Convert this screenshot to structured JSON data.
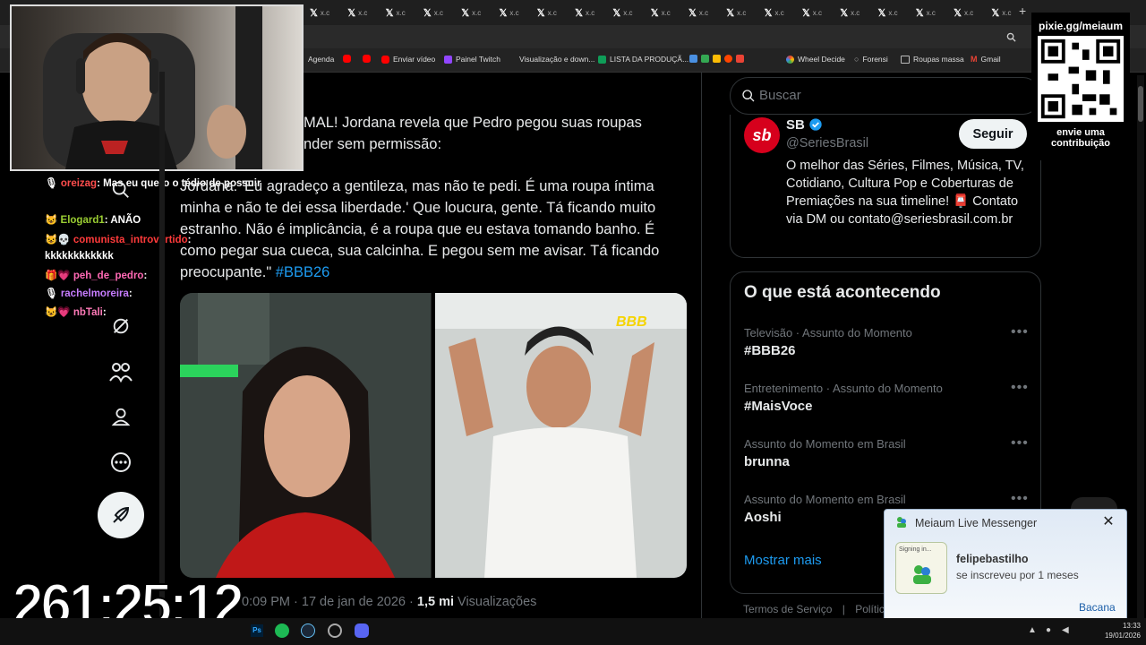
{
  "browser": {
    "tab_label": "x.c",
    "bookmarks": [
      {
        "label": "Agenda",
        "color": "#4a7bd0"
      },
      {
        "label": "",
        "color": "#ff0000"
      },
      {
        "label": "Enviar vídeo",
        "color": "#ff0000"
      },
      {
        "label": "Painel Twitch",
        "color": "#9146ff"
      },
      {
        "label": "Visualização e down...",
        "color": ""
      },
      {
        "label": "LISTA DA PRODUÇÃ...",
        "color": "#0f9d58"
      },
      {
        "label": "Wheel Decide",
        "color": "#ffb300"
      },
      {
        "label": "Forensi",
        "color": "#888888"
      },
      {
        "label": "Roupas massa",
        "color": "#aaaaaa"
      },
      {
        "label": "Gmail",
        "color": "#ea4335"
      }
    ]
  },
  "overlay": {
    "qr_url": "pixie.gg/meiaum",
    "qr_caption": "envie uma contribuição",
    "timer": "261:25:12"
  },
  "chat": [
    {
      "user": "oreizag",
      "user_color": "#ff4d4d",
      "sep": ":",
      "message": "Mas eu quero o tédio de possuir"
    },
    {
      "user": "Elogard1",
      "user_color": "#9acd32",
      "sep": ":",
      "message": "ANÃO"
    },
    {
      "user": "comunista_introvertido",
      "user_color": "#ff3b3b",
      "sep": ":",
      "message": "kkkkkkkkkkkk"
    },
    {
      "user": "peh_de_pedro",
      "user_color": "#ff69b4",
      "sep": ":",
      "message": ""
    },
    {
      "user": "rachelmoreira",
      "user_color": "#c77dff",
      "sep": ":",
      "message": ""
    },
    {
      "user": "nbTali",
      "user_color": "#ff7ab8",
      "sep": ":",
      "message": ""
    }
  ],
  "tweet": {
    "headline_lines": [
      "MAL! Jordana revela que Pedro pegou suas roupas",
      "nder sem permissão:"
    ],
    "body_prefix": "Jordana: 'Eu agradeço a gentileza, mas não te pedi. É uma roupa íntima minha e não te dei essa liberdade.' Que loucura, gente. Tá ficando muito estranho. Não é implicância, é a roupa que eu estava tomando banho. É como pegar sua cueca, sua calcinha. E pegou sem me avisar. Tá ficando preocupante.\"",
    "hashtag": "#BBB26",
    "timestamp_suffix": "0:09 PM · 17 de jan de 2026 ·",
    "views_count": "1,5 mi",
    "views_label": "Visualizações",
    "media_badge": "BBB"
  },
  "right": {
    "search_placeholder": "Buscar",
    "profile": {
      "name": "SB",
      "handle": "@SeriesBrasil",
      "follow_label": "Seguir",
      "bio": "O melhor das Séries, Filmes, Música, TV, Cotidiano, Cultura Pop e Coberturas de Premiações na sua timeline! 📮 Contato via DM ou contato@seriesbrasil.com.br"
    },
    "trends_title": "O que está acontecendo",
    "trends": [
      {
        "meta": "Televisão · Assunto do Momento",
        "name": "#BBB26"
      },
      {
        "meta": "Entretenimento · Assunto do Momento",
        "name": "#MaisVoce"
      },
      {
        "meta": "Assunto do Momento em Brasil",
        "name": "brunna"
      },
      {
        "meta": "Assunto do Momento em Brasil",
        "name": "Aoshi"
      }
    ],
    "show_more": "Mostrar mais",
    "footer": [
      "Termos de Serviço",
      "|",
      "Política"
    ]
  },
  "popup": {
    "title": "Meiaum Live Messenger",
    "signing_in": "Signing in...",
    "user": "felipebastilho",
    "message": "se inscreveu por 1 meses",
    "action": "Bacana"
  },
  "taskbar": {
    "time": "13:33",
    "date": "19/01/2026"
  }
}
